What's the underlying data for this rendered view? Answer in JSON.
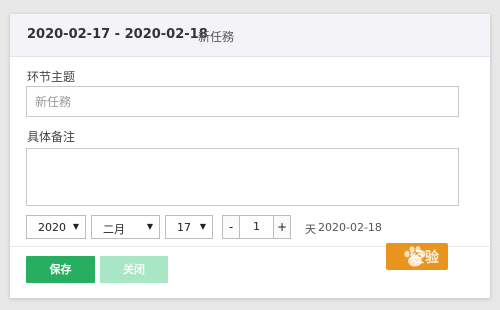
{
  "header": {
    "date_range": "2020-02-17 - 2020-02-18",
    "subject": "新任務"
  },
  "form": {
    "topic_label": "环节主题",
    "topic_placeholder": "新任務",
    "notes_label": "具体备注",
    "notes_value": ""
  },
  "date_picker": {
    "year": "2020",
    "month": "二月",
    "day": "17",
    "minus_label": "-",
    "duration": "1",
    "plus_label": "+",
    "unit_label": "天",
    "end_date": "2020-02-18"
  },
  "footer": {
    "save_label": "保存",
    "close_label": "关闭"
  },
  "watermark": {
    "text": "经验"
  },
  "colors": {
    "save_button": "#27ae60",
    "close_button": "#a9e6c4",
    "header_bg": "#f4f4f8",
    "watermark_bg": "#e8941e"
  }
}
